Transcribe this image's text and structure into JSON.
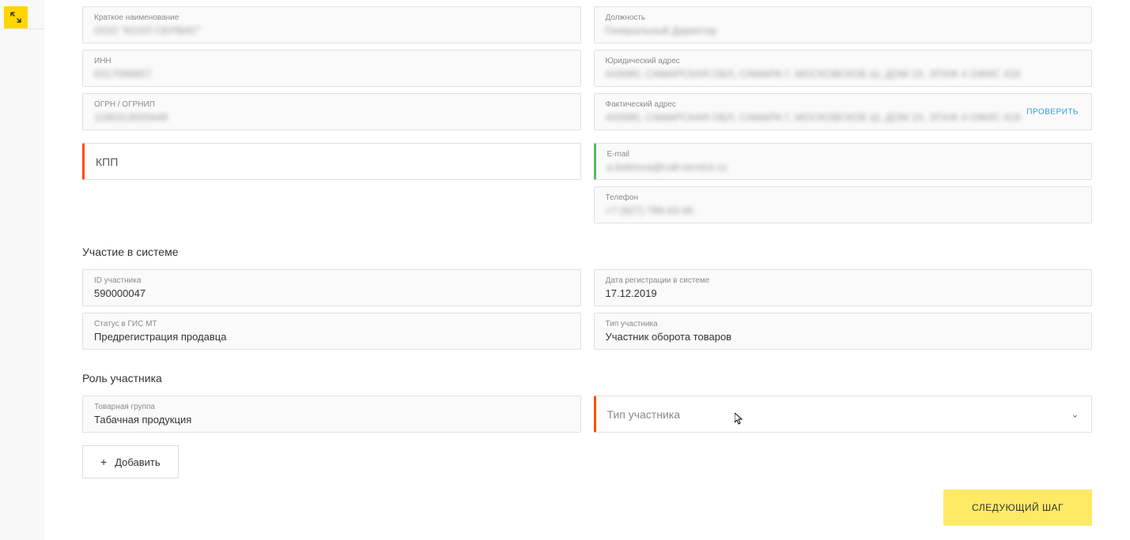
{
  "topFields": {
    "shortName": {
      "label": "Краткое наименование",
      "value": "ООО \"КОЛЛ СЕРВИС\""
    },
    "position": {
      "label": "Должность",
      "value": "Генеральный Директор"
    },
    "inn": {
      "label": "ИНН",
      "value": "6317096857"
    },
    "legalAddress": {
      "label": "Юридический адрес",
      "value": "443080, САМАРСКАЯ ОБЛ, САМАРА Г, МОСКОВСКОЕ Ш, ДОМ 15, ЭТАЖ 4 ОФИС 418"
    },
    "ogrn": {
      "label": "ОГРН / ОГРНИП",
      "value": "1186313005948"
    },
    "actualAddress": {
      "label": "Фактический адрес",
      "value": "443080, САМАРСКАЯ ОБЛ, САМАРА Г, МОСКОВСКОЕ Ш, ДОМ 15, ЭТАЖ 4 ОФИС 418",
      "link": "ПРОВЕРИТЬ"
    },
    "kpp": {
      "placeholder": "КПП"
    },
    "email": {
      "label": "E-mail",
      "value": "a.bobrova@call-service.ru"
    },
    "phone": {
      "label": "Телефон",
      "value": "+7 (927) 786-63-90"
    }
  },
  "sections": {
    "participation": "Участие в системе",
    "role": "Роль участника"
  },
  "participation": {
    "id": {
      "label": "ID участника",
      "value": "590000047"
    },
    "regDate": {
      "label": "Дата регистрации в системе",
      "value": "17.12.2019"
    },
    "status": {
      "label": "Статус в ГИС МТ",
      "value": "Предрегистрация продавца"
    },
    "type": {
      "label": "Тип участника",
      "value": "Участник оборота товаров"
    }
  },
  "role": {
    "group": {
      "label": "Товарная группа",
      "value": "Табачная продукция"
    },
    "type": {
      "placeholder": "Тип участника"
    }
  },
  "buttons": {
    "add": "Добавить",
    "next": "СЛЕДУЮЩИЙ ШАГ"
  }
}
